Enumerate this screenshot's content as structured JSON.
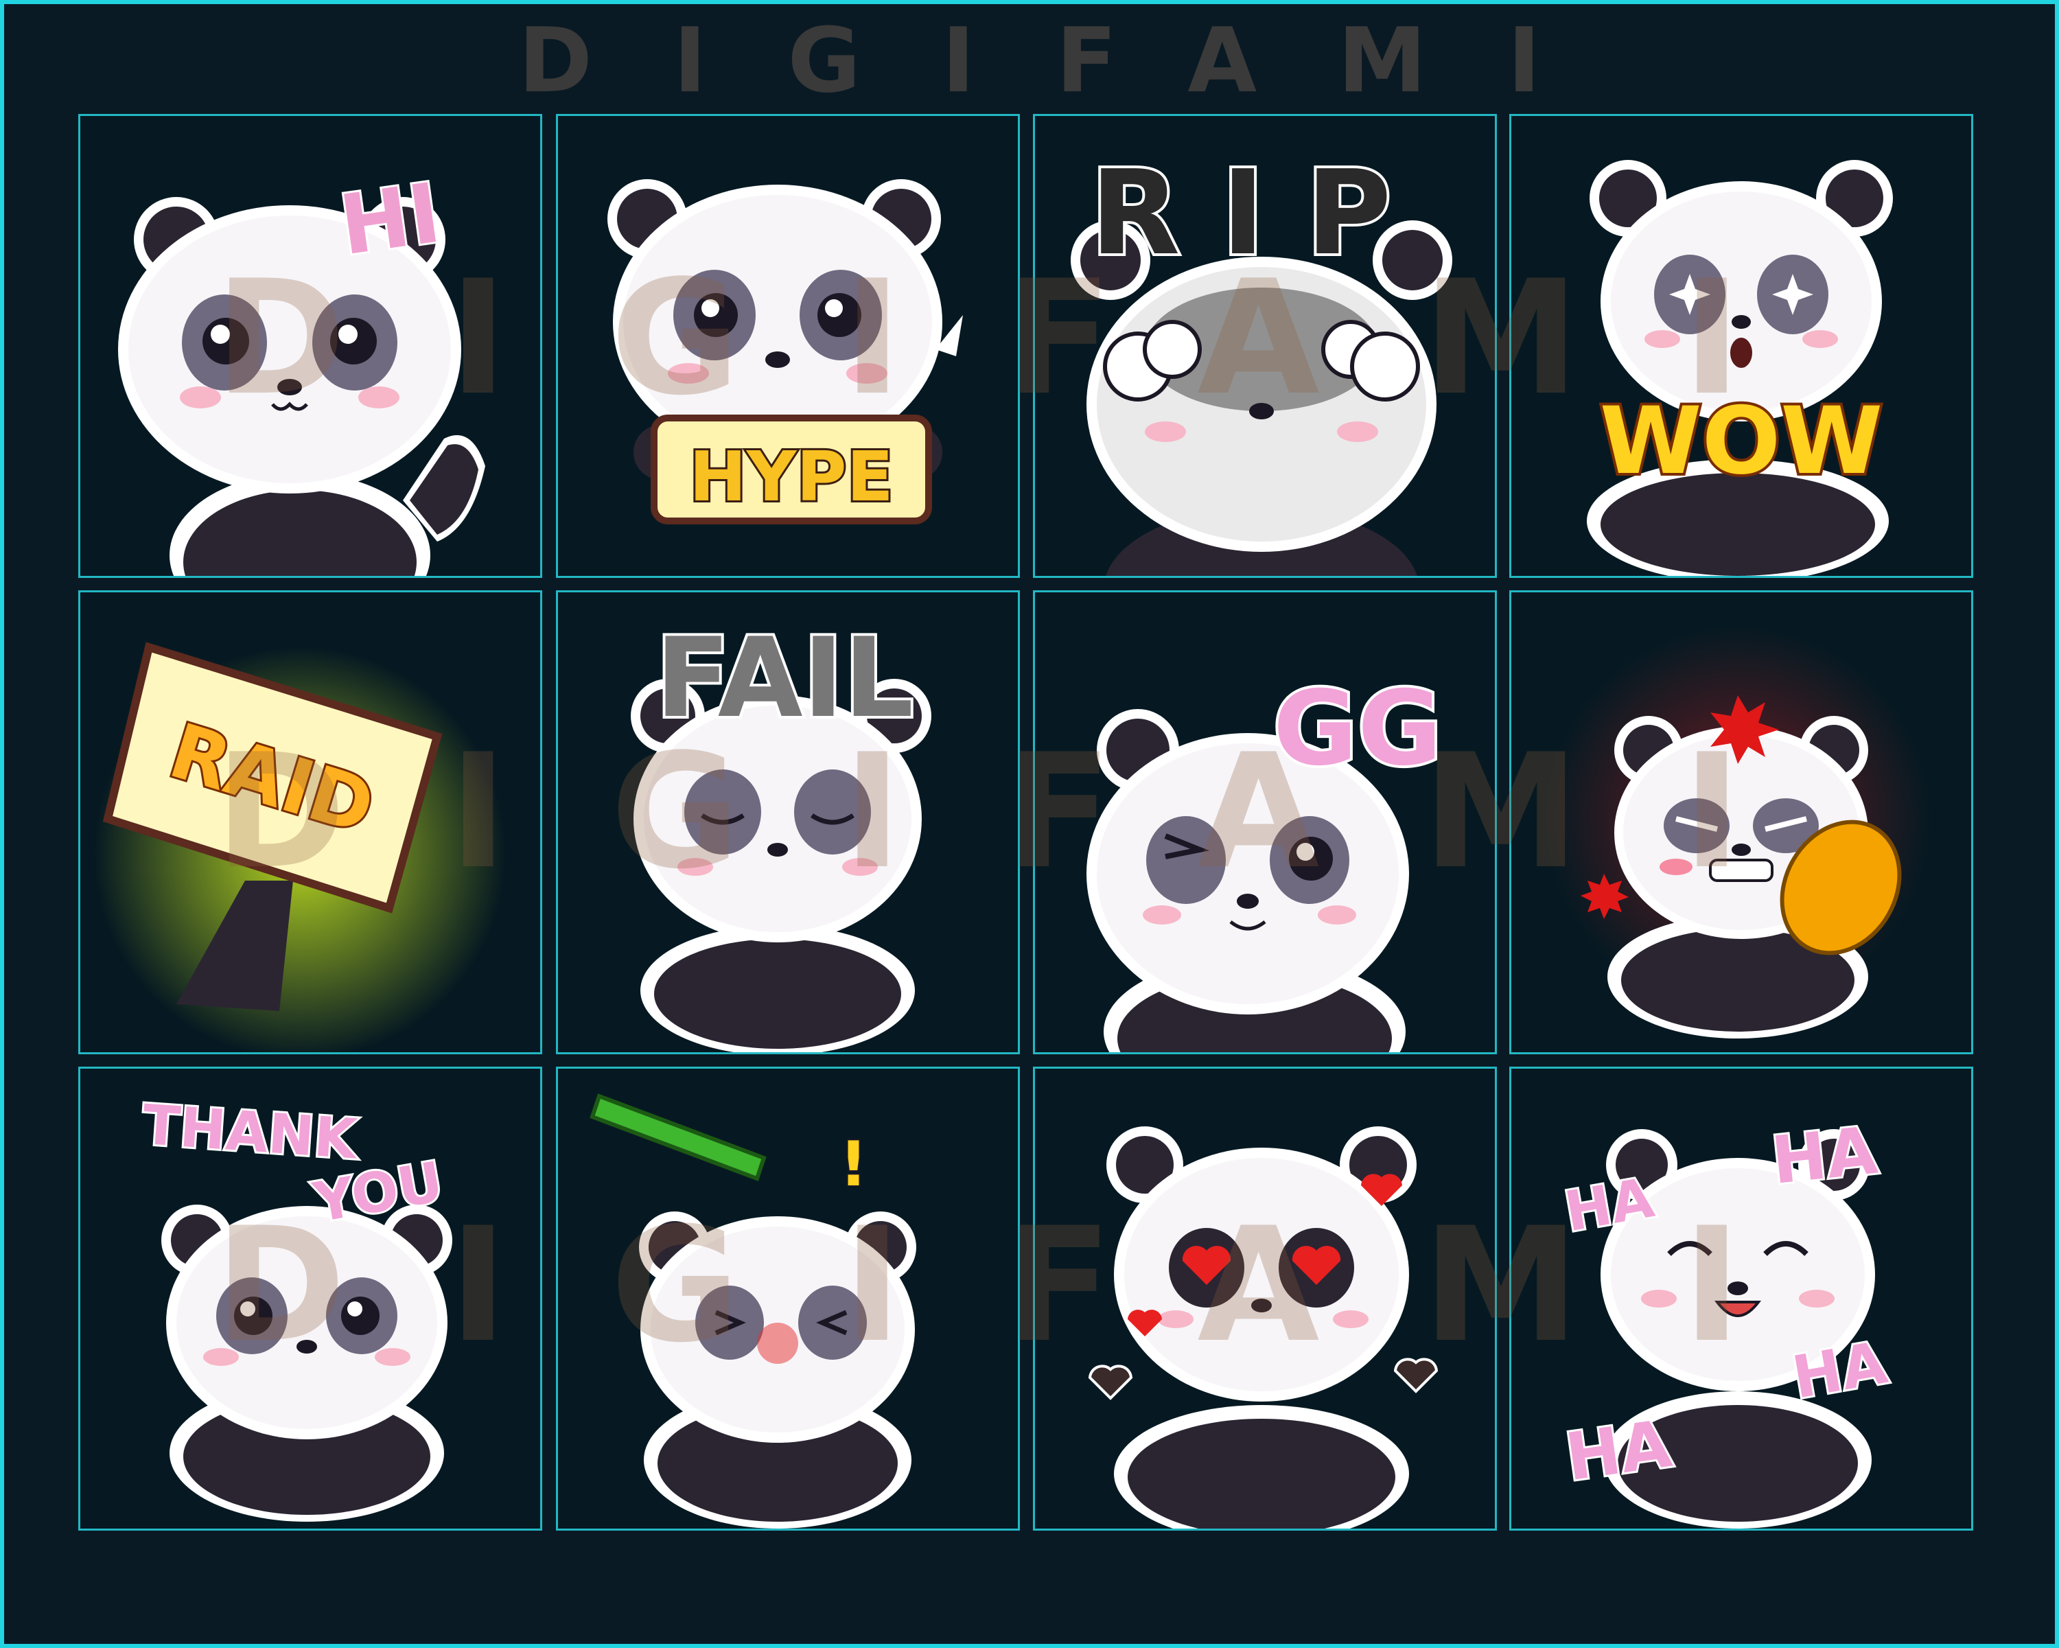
{
  "brand": "DIGIFAMI",
  "watermark": "DIGIFAMI",
  "colors": {
    "background": "#0a1a24",
    "frame": "#22d3e0",
    "cell_border": "#22b8c4",
    "cell_bg": "#061922"
  },
  "emotes": [
    {
      "label": "HI",
      "icon": "panda-waving-icon"
    },
    {
      "label": "HYPE",
      "icon": "panda-hype-sign-icon"
    },
    {
      "label": "RIP",
      "icon": "panda-rip-icon"
    },
    {
      "label": "WOW",
      "icon": "panda-wow-icon"
    },
    {
      "label": "RAID",
      "icon": "raid-sign-icon"
    },
    {
      "label": "FAIL",
      "icon": "panda-fail-icon"
    },
    {
      "label": "GG",
      "icon": "panda-wink-icon"
    },
    {
      "label": "",
      "icon": "panda-angry-icon"
    },
    {
      "label": "THANK",
      "label2": "YOU",
      "icon": "panda-thank-you-icon"
    },
    {
      "label": "!",
      "icon": "panda-bonked-icon"
    },
    {
      "label": "",
      "icon": "panda-love-icon"
    },
    {
      "label": "HA",
      "label2": "HA",
      "label3": "HA",
      "label4": "HA",
      "icon": "panda-laughing-icon"
    }
  ]
}
